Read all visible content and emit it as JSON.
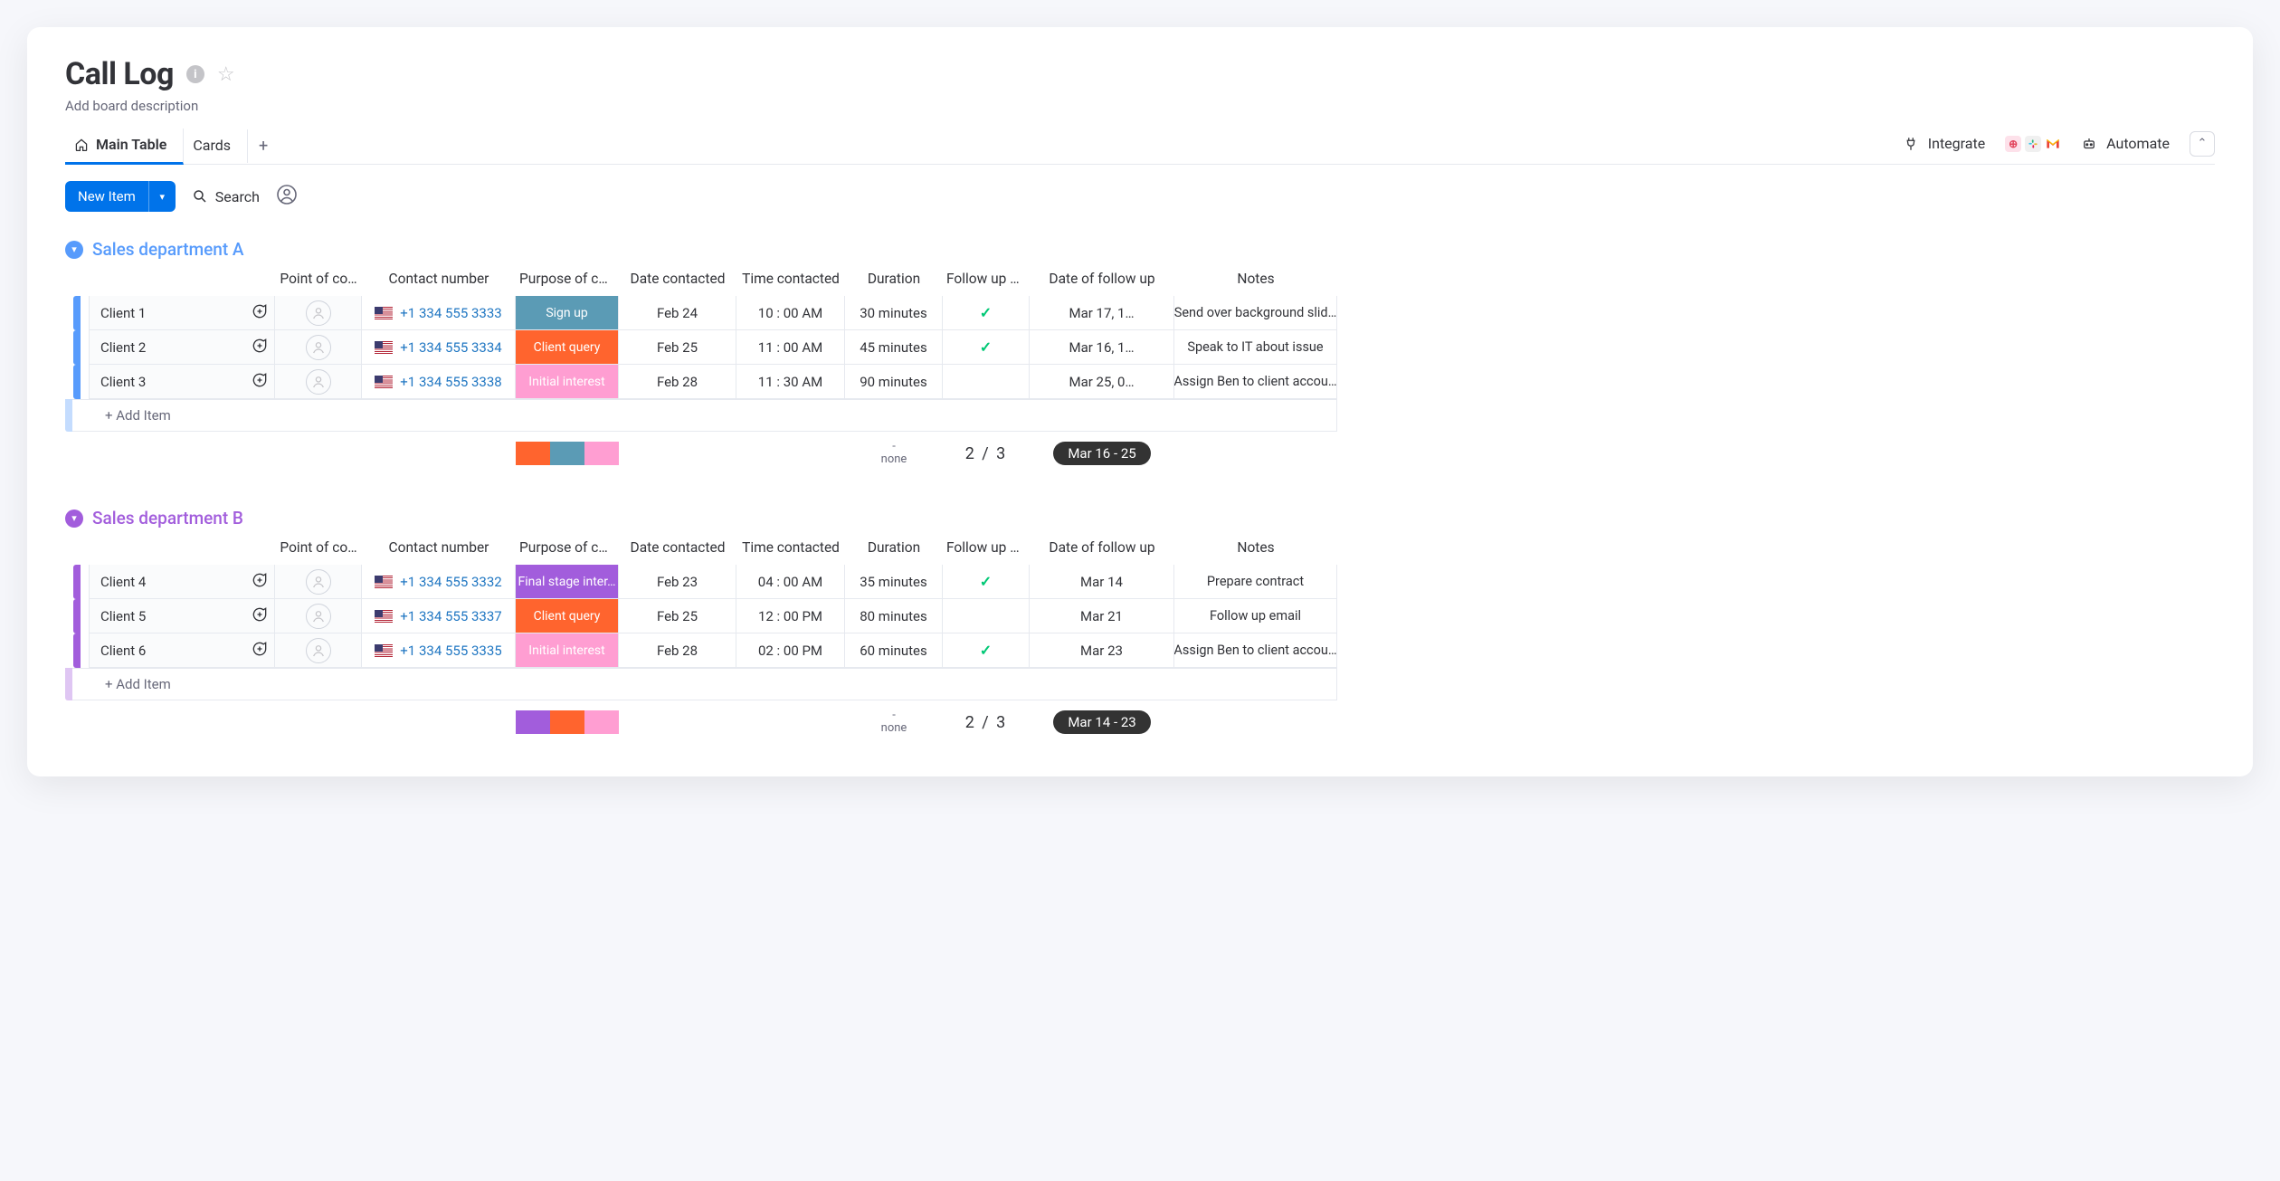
{
  "header": {
    "title": "Call Log",
    "description_placeholder": "Add board description"
  },
  "tabs": {
    "items": [
      {
        "label": "Main Table",
        "active": true,
        "icon": "home"
      },
      {
        "label": "Cards",
        "active": false
      }
    ],
    "add_label": "+"
  },
  "top_right": {
    "integrate_label": "Integrate",
    "automate_label": "Automate"
  },
  "toolbar": {
    "new_item_label": "New Item",
    "search_label": "Search"
  },
  "columns_truncated": {
    "poc": "Point of co…",
    "contact": "Contact number",
    "purpose": "Purpose of co…",
    "date": "Date contacted",
    "time": "Time contacted",
    "duration": "Duration",
    "followup": "Follow up p…",
    "follow_date": "Date of follow up",
    "notes": "Notes"
  },
  "groups": [
    {
      "id": "group-a",
      "title": "Sales department A",
      "color": "#579bfc",
      "rows": [
        {
          "name": "Client 1",
          "phone": "+1 334 555 3333",
          "purpose": "Sign up",
          "purpose_color": "#5b9bb5",
          "date": "Feb 24",
          "time": "10 : 00 AM",
          "duration": "30 minutes",
          "followup": true,
          "follow_date": "Mar 17, 1…",
          "notes": "Send over background slid…"
        },
        {
          "name": "Client 2",
          "phone": "+1 334 555 3334",
          "purpose": "Client query",
          "purpose_color": "#ff642e",
          "date": "Feb 25",
          "time": "11 : 00 AM",
          "duration": "45 minutes",
          "followup": true,
          "follow_date": "Mar 16, 1…",
          "notes": "Speak to IT about issue"
        },
        {
          "name": "Client 3",
          "phone": "+1 334 555 3338",
          "purpose": "Initial interest",
          "purpose_color": "#ff9ed2",
          "date": "Feb 28",
          "time": "11 : 30 AM",
          "duration": "90 minutes",
          "followup": false,
          "follow_date": "Mar 25, 0…",
          "notes": "Assign Ben to client accou…"
        }
      ],
      "add_item_label": "+ Add Item",
      "summary": {
        "segments": [
          "#ff642e",
          "#5b9bb5",
          "#ff9ed2"
        ],
        "duration_top": "-",
        "duration_bottom": "none",
        "followup_count": "2 / 3",
        "date_range": "Mar 16 - 25"
      }
    },
    {
      "id": "group-b",
      "title": "Sales department B",
      "color": "#a25ddc",
      "rows": [
        {
          "name": "Client 4",
          "phone": "+1 334 555 3332",
          "purpose": "Final stage inter…",
          "purpose_color": "#a25ddc",
          "date": "Feb 23",
          "time": "04 : 00 AM",
          "duration": "35 minutes",
          "followup": true,
          "follow_date": "Mar 14",
          "notes": "Prepare contract"
        },
        {
          "name": "Client 5",
          "phone": "+1 334 555 3337",
          "purpose": "Client query",
          "purpose_color": "#ff642e",
          "date": "Feb 25",
          "time": "12 : 00 PM",
          "duration": "80 minutes",
          "followup": false,
          "follow_date": "Mar 21",
          "notes": "Follow up email"
        },
        {
          "name": "Client 6",
          "phone": "+1 334 555 3335",
          "purpose": "Initial interest",
          "purpose_color": "#ff9ed2",
          "date": "Feb 28",
          "time": "02 : 00 PM",
          "duration": "60 minutes",
          "followup": true,
          "follow_date": "Mar 23",
          "notes": "Assign Ben to client accou…"
        }
      ],
      "add_item_label": "+ Add Item",
      "summary": {
        "segments": [
          "#a25ddc",
          "#ff642e",
          "#ff9ed2"
        ],
        "duration_top": "-",
        "duration_bottom": "none",
        "followup_count": "2 / 3",
        "date_range": "Mar 14 - 23"
      }
    }
  ]
}
